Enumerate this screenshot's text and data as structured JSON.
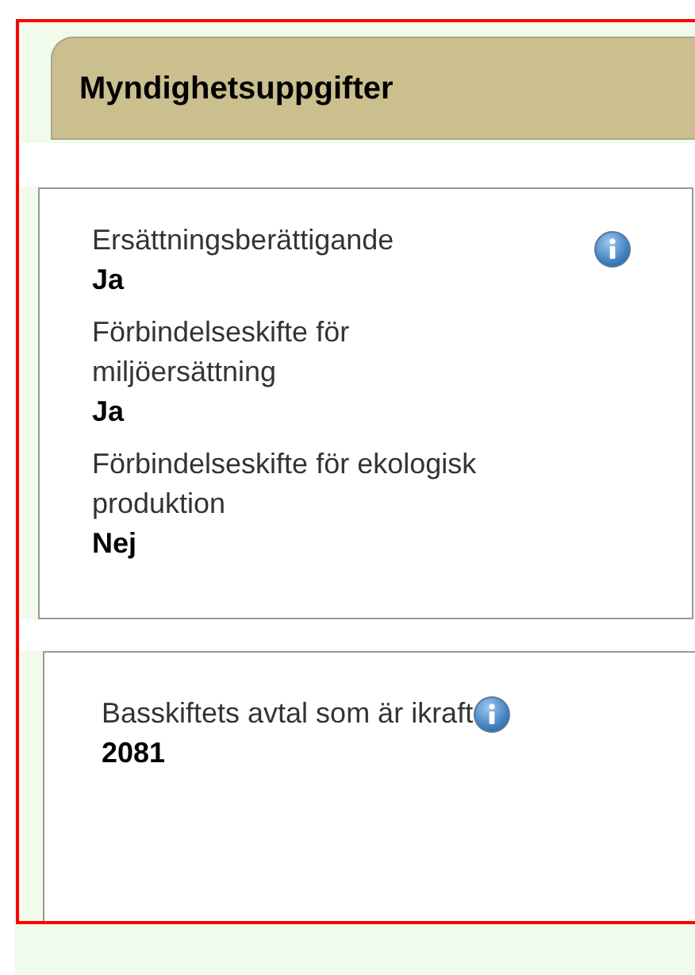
{
  "header": {
    "title": "Myndighetsuppgifter"
  },
  "sections": [
    {
      "fields": [
        {
          "label": "Ersättningsberättigande",
          "value": "Ja",
          "info": true
        },
        {
          "label": "Förbindelseskifte för miljöersättning",
          "value": "Ja",
          "info": false
        },
        {
          "label": "Förbindelseskifte för ekologisk produktion",
          "value": "Nej",
          "info": false
        }
      ]
    },
    {
      "fields": [
        {
          "label": "Basskiftets avtal som är ikraft",
          "value": "2081",
          "info": true
        }
      ]
    }
  ]
}
